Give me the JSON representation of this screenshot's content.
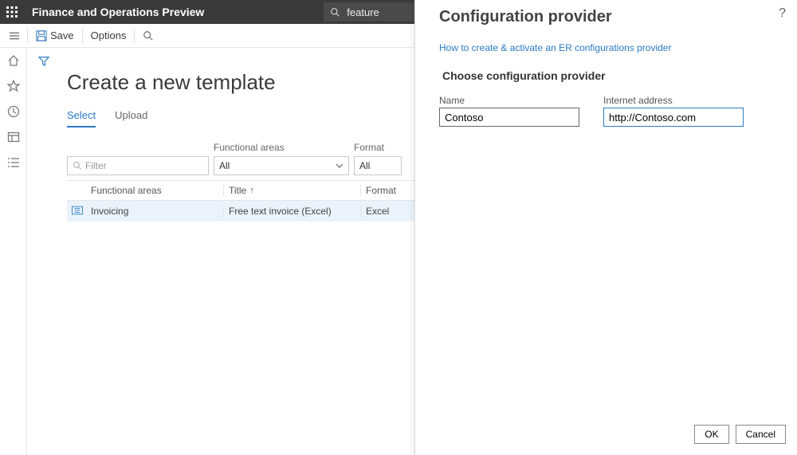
{
  "topbar": {
    "app_title": "Finance and Operations Preview",
    "search_value": "feature"
  },
  "actionbar": {
    "save_label": "Save",
    "options_label": "Options"
  },
  "page": {
    "title": "Create a new template",
    "tabs": {
      "select": "Select",
      "upload": "Upload"
    },
    "filters": {
      "filterbox_placeholder": "Filter",
      "functional_areas_label": "Functional areas",
      "functional_areas_value": "All",
      "format_label": "Format",
      "format_value": "All"
    },
    "table": {
      "columns": {
        "functional_areas": "Functional areas",
        "title": "Title",
        "format": "Format"
      },
      "row": {
        "functional_areas": "Invoicing",
        "title": "Free text invoice (Excel)",
        "format": "Excel"
      }
    }
  },
  "panel": {
    "title": "Configuration provider",
    "link": "How to create & activate an ER configurations provider",
    "subtitle": "Choose configuration provider",
    "name_label": "Name",
    "name_value": "Contoso",
    "url_label": "Internet address",
    "url_value": "http://Contoso.com",
    "ok": "OK",
    "cancel": "Cancel"
  }
}
